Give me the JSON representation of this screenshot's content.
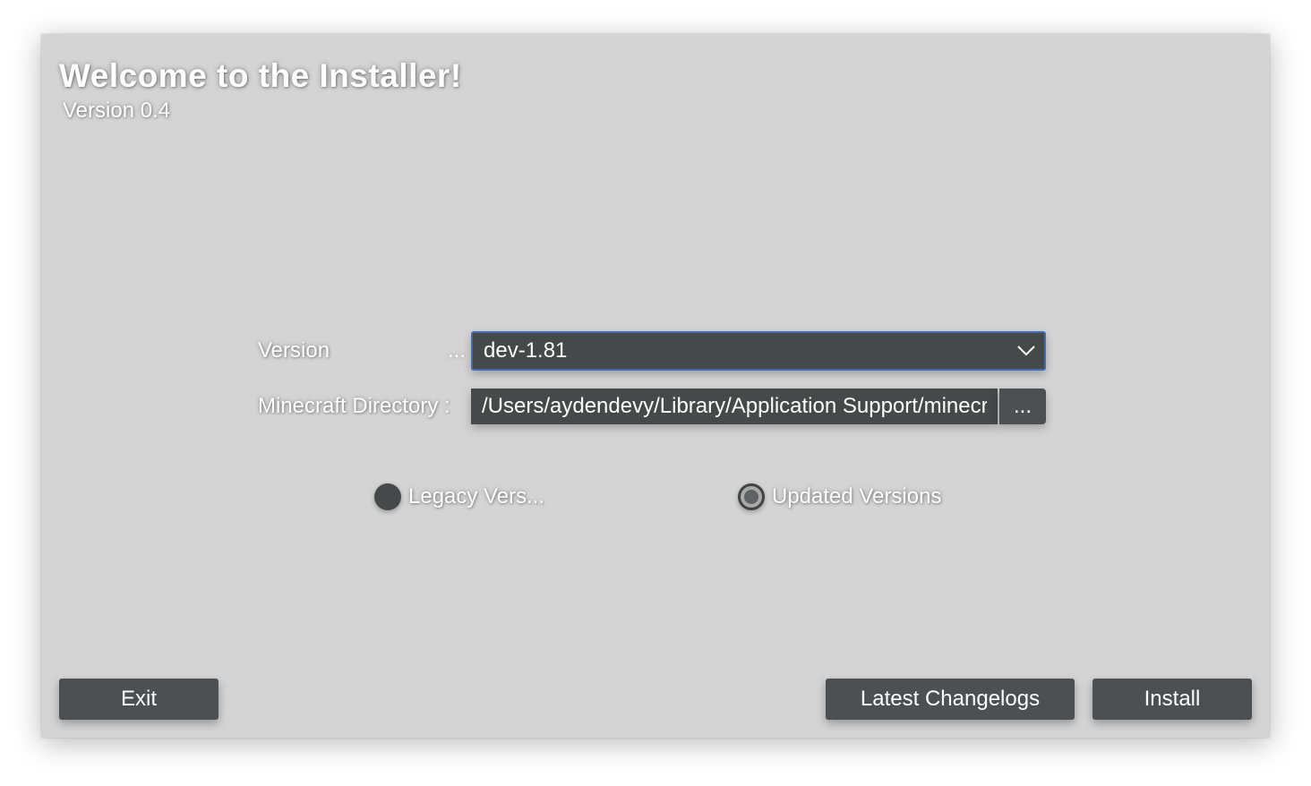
{
  "window": {
    "title": "Welcome to the Installer!",
    "subtitle": "Version 0.4"
  },
  "form": {
    "version_label": "Version",
    "version_ellipsis": "...",
    "version_selected": "dev-1.81",
    "directory_label": "Minecraft Directory :",
    "directory_value": "/Users/aydendevy/Library/Application Support/minecraft",
    "browse_label": "..."
  },
  "radios": {
    "legacy_label": "Legacy Vers...",
    "updated_label": "Updated Versions",
    "selected": "updated"
  },
  "buttons": {
    "exit": "Exit",
    "changelogs": "Latest Changelogs",
    "install": "Install"
  },
  "colors": {
    "window_bg": "#d4d4d4",
    "control_bg": "#45494a",
    "button_bg": "#4c5052",
    "focus_border": "#3d6dba"
  }
}
